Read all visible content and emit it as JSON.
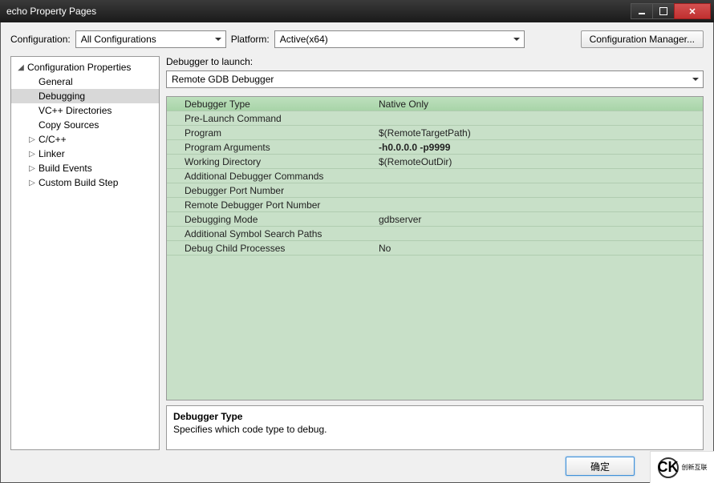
{
  "title": "echo Property Pages",
  "toprow": {
    "config_label": "Configuration:",
    "config_value": "All Configurations",
    "platform_label": "Platform:",
    "platform_value": "Active(x64)",
    "manager_button": "Configuration Manager..."
  },
  "tree": {
    "root": "Configuration Properties",
    "items": [
      {
        "label": "General",
        "expandable": false
      },
      {
        "label": "Debugging",
        "expandable": false,
        "selected": true
      },
      {
        "label": "VC++ Directories",
        "expandable": false
      },
      {
        "label": "Copy Sources",
        "expandable": false
      },
      {
        "label": "C/C++",
        "expandable": true
      },
      {
        "label": "Linker",
        "expandable": true
      },
      {
        "label": "Build Events",
        "expandable": true
      },
      {
        "label": "Custom Build Step",
        "expandable": true
      }
    ]
  },
  "launcher": {
    "label": "Debugger to launch:",
    "value": "Remote GDB Debugger"
  },
  "props": [
    {
      "name": "Debugger Type",
      "value": "Native Only",
      "highlight": true
    },
    {
      "name": "Pre-Launch Command",
      "value": ""
    },
    {
      "name": "Program",
      "value": "$(RemoteTargetPath)"
    },
    {
      "name": "Program Arguments",
      "value": "-h0.0.0.0 -p9999",
      "bold": true
    },
    {
      "name": "Working Directory",
      "value": "$(RemoteOutDir)"
    },
    {
      "name": "Additional Debugger Commands",
      "value": ""
    },
    {
      "name": "Debugger Port Number",
      "value": ""
    },
    {
      "name": "Remote Debugger Port Number",
      "value": ""
    },
    {
      "name": "Debugging Mode",
      "value": "gdbserver"
    },
    {
      "name": "Additional Symbol Search Paths",
      "value": ""
    },
    {
      "name": "Debug Child Processes",
      "value": "No"
    }
  ],
  "description": {
    "title": "Debugger Type",
    "text": "Specifies which code type to debug."
  },
  "buttons": {
    "ok": "确定"
  },
  "watermark": {
    "logo": "CK",
    "text": "创新互联"
  }
}
